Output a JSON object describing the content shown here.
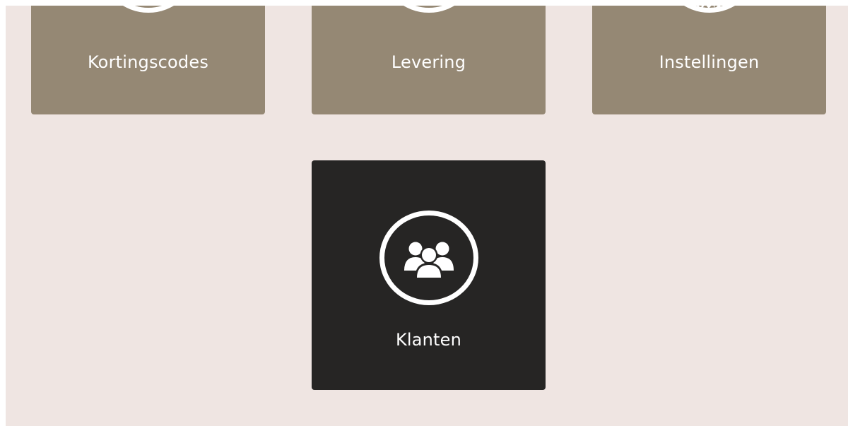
{
  "tiles": [
    {
      "label": "Kortingscodes",
      "icon": "discount-icon"
    },
    {
      "label": "Levering",
      "icon": "delivery-icon"
    },
    {
      "label": "Instellingen",
      "icon": "gear-icon"
    },
    {
      "label": "Klanten",
      "icon": "customers-icon",
      "active": true
    }
  ],
  "colors": {
    "page_bg": "#efe5e2",
    "tile_bg": "#958874",
    "tile_active_bg": "#262524",
    "text": "#ffffff"
  }
}
